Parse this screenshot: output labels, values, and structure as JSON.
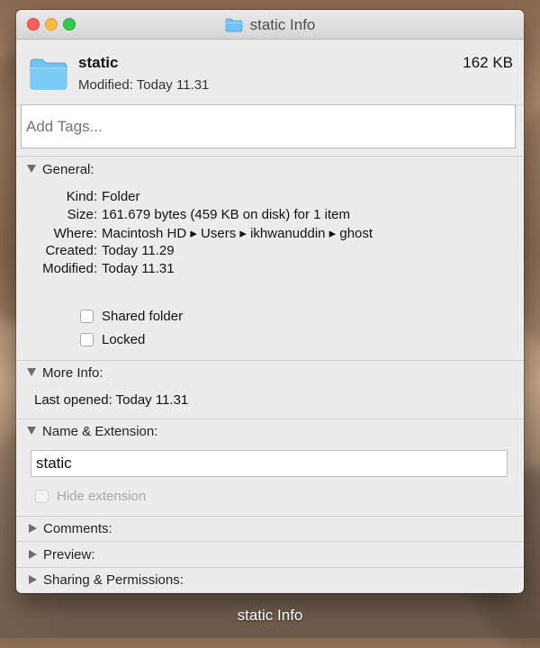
{
  "window": {
    "title": "static Info"
  },
  "header": {
    "name": "static",
    "modified_label": "Modified:",
    "modified_value": "Today 11.31",
    "size": "162 KB",
    "tags_placeholder": "Add Tags..."
  },
  "general": {
    "heading": "General:",
    "rows": [
      {
        "key": "Kind:",
        "value": "Folder"
      },
      {
        "key": "Size:",
        "value": "161.679 bytes (459 KB on disk) for 1 item"
      },
      {
        "key": "Where:",
        "value": "Macintosh HD ▸ Users ▸ ikhwanuddin ▸ ghost"
      },
      {
        "key": "Created:",
        "value": "Today 11.29"
      },
      {
        "key": "Modified:",
        "value": "Today 11.31"
      }
    ],
    "shared_folder_label": "Shared folder",
    "locked_label": "Locked"
  },
  "more_info": {
    "heading": "More Info:",
    "last_opened_label": "Last opened:",
    "last_opened_value": "Today 11.31"
  },
  "name_ext": {
    "heading": "Name & Extension:",
    "name_value": "static",
    "hide_extension_label": "Hide extension"
  },
  "comments": {
    "heading": "Comments:"
  },
  "preview": {
    "heading": "Preview:"
  },
  "sharing": {
    "heading": "Sharing & Permissions:"
  },
  "desktop_caption": "static Info",
  "colors": {
    "folder_blue": "#6ec3f4",
    "close": "#fc605c",
    "minimize": "#fdbc40",
    "maximize": "#34c84a"
  }
}
